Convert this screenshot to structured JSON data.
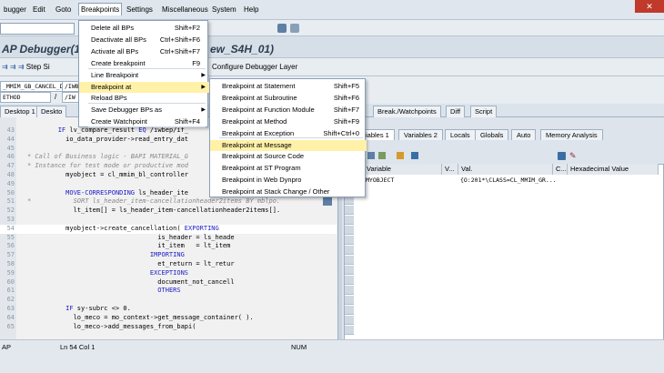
{
  "menubar": {
    "items": [
      "bugger",
      "Edit",
      "Goto",
      "Breakpoints",
      "Settings",
      "Miscellaneous",
      "System",
      "Help"
    ]
  },
  "window": {
    "title_left": "AP Debugger(1)",
    "title_right": "ew_S4H_01)"
  },
  "apptoolbar": {
    "step_label": "Step Si",
    "config_label": "Configure Debugger Layer"
  },
  "inforow": {
    "field1": "_MMIM_GB_CANCEL_DPC_",
    "sep": "/",
    "field2": "/IWB",
    "field3": "/IW",
    "field4": "ETHOD"
  },
  "desktabs": [
    "Desktop 1",
    "Deskto"
  ],
  "righttabs": [
    "Break./Watchpoints",
    "Diff",
    "Script"
  ],
  "vartabs": [
    "iables 1",
    "Variables 2",
    "Locals",
    "Globals",
    "Auto",
    "Memory Analysis"
  ],
  "vargrid": {
    "headers": [
      "Variable",
      "V...",
      "Val.",
      "C...",
      "Hexadecimal Value"
    ],
    "rows": [
      {
        "variable": "MYOBJECT",
        "value": "{O:201*\\CLASS=CL_MMIM_GR..."
      }
    ]
  },
  "code": [
    {
      "n": "43",
      "t": "        IF lv_compare_result EQ /iwbep/if_"
    },
    {
      "n": "44",
      "t": "          io_data_provider->read_entry_dat"
    },
    {
      "n": "45",
      "t": ""
    },
    {
      "n": "46",
      "t": "* Call of Business logic - BAPI MATERIAL_G",
      "c": true
    },
    {
      "n": "47",
      "t": "* Instance for test mode or productive mod",
      "c": true
    },
    {
      "n": "48",
      "t": "          myobject = cl_mmim_bl_controller"
    },
    {
      "n": "49",
      "t": ""
    },
    {
      "n": "50",
      "t": "          MOVE-CORRESPONDING ls_header_ite"
    },
    {
      "n": "51",
      "t": "*           SORT ls_header_item-cancellationheader2items BY mblpo.",
      "c": true
    },
    {
      "n": "52",
      "t": "            lt_item[] = ls_header_item-cancellationheader2items[]."
    },
    {
      "n": "53",
      "t": ""
    },
    {
      "n": "54",
      "t": "          myobject->create_cancellation( EXPORTING",
      "hl": true
    },
    {
      "n": "55",
      "t": "                                  is_header = ls_heade"
    },
    {
      "n": "56",
      "t": "                                  it_item   = lt_item"
    },
    {
      "n": "57",
      "t": "                                IMPORTING"
    },
    {
      "n": "58",
      "t": "                                  et_return = lt_retur"
    },
    {
      "n": "59",
      "t": "                                EXCEPTIONS"
    },
    {
      "n": "60",
      "t": "                                  document_not_cancell"
    },
    {
      "n": "61",
      "t": "                                  OTHERS"
    },
    {
      "n": "62",
      "t": ""
    },
    {
      "n": "63",
      "t": "          IF sy-subrc <> 0."
    },
    {
      "n": "64",
      "t": "            lo_meco = mo_context->get_message_container( )."
    },
    {
      "n": "65",
      "t": "            lo_meco->add_messages_from_bapi("
    }
  ],
  "statusbar": {
    "left": "AP",
    "pos_label": "Ln 54 Col 1",
    "num": "NUM"
  },
  "breakpoints_menu": {
    "items": [
      {
        "label": "Delete all BPs",
        "shortcut": "Shift+F2"
      },
      {
        "label": "Deactivate all BPs",
        "shortcut": "Ctrl+Shift+F6"
      },
      {
        "label": "Activate all BPs",
        "shortcut": "Ctrl+Shift+F7"
      },
      {
        "label": "Create breakpoint",
        "shortcut": "F9"
      },
      {
        "label": "Line Breakpoint",
        "shortcut": "",
        "submenu": true
      },
      {
        "label": "Breakpoint at",
        "shortcut": "",
        "submenu": true,
        "hover": true
      },
      {
        "label": "Reload BPs",
        "shortcut": ""
      },
      {
        "label": "Save Debugger BPs as",
        "shortcut": "",
        "submenu": true
      },
      {
        "label": "Create Watchpoint",
        "shortcut": "Shift+F4"
      }
    ]
  },
  "breakpoint_at_submenu": {
    "items": [
      {
        "label": "Breakpoint at Statement",
        "shortcut": "Shift+F5"
      },
      {
        "label": "Breakpoint at Subroutine",
        "shortcut": "Shift+F6"
      },
      {
        "label": "Breakpoint at Function Module",
        "shortcut": "Shift+F7"
      },
      {
        "label": "Breakpoint at Method",
        "shortcut": "Shift+F9"
      },
      {
        "label": "Breakpoint at Exception",
        "shortcut": "Shift+Ctrl+0"
      },
      {
        "label": "Breakpoint at Message",
        "shortcut": "",
        "hover": true
      },
      {
        "label": "Breakpoint at Source Code",
        "shortcut": ""
      },
      {
        "label": "Breakpoint at ST Program",
        "shortcut": ""
      },
      {
        "label": "Breakpoint in Web Dynpro",
        "shortcut": ""
      },
      {
        "label": "Breakpoint at Stack Change / Other",
        "shortcut": ""
      }
    ]
  },
  "colors": {
    "accent": "#fff1a8",
    "keyword": "#1a1ac4",
    "close": "#c0392b"
  },
  "icons": [
    "close-icon",
    "step-icon",
    "layer-icon",
    "save-icon",
    "delete-icon",
    "submenu-arrow-icon"
  ]
}
